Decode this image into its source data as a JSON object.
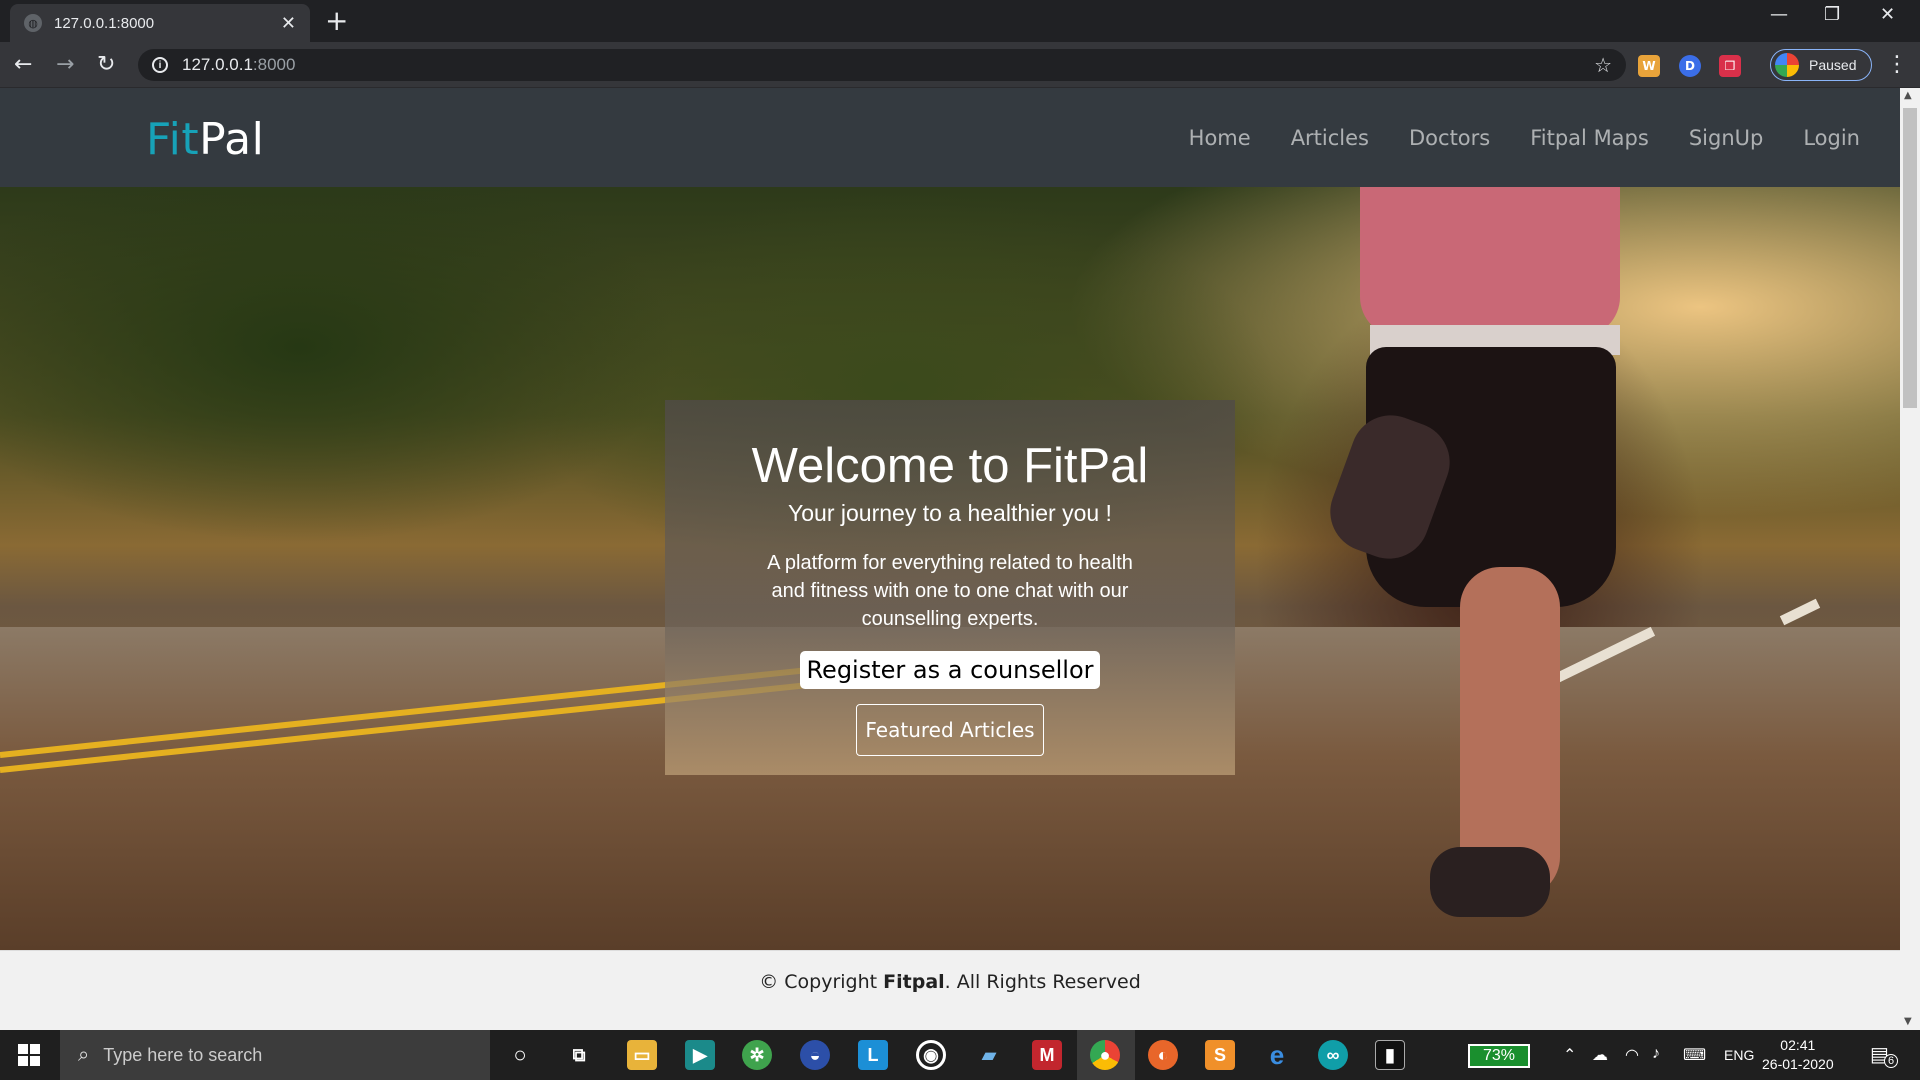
{
  "browser": {
    "tab_title": "127.0.0.1:8000",
    "url_host": "127.0.0.1",
    "url_port": ":8000",
    "profile_status": "Paused"
  },
  "site": {
    "brand_part1": "Fit",
    "brand_part2": "Pal",
    "nav": [
      "Home",
      "Articles",
      "Doctors",
      "Fitpal Maps",
      "SignUp",
      "Login"
    ],
    "hero": {
      "title": "Welcome to FitPal",
      "subtitle": "Your journey to a healthier you !",
      "description": "A platform for everything related to health and fitness with one to one chat with our counselling experts.",
      "register_button": "Register as a counsellor",
      "featured_button": "Featured Articles"
    },
    "footer": {
      "prefix": "© Copyright ",
      "brand": "Fitpal",
      "suffix": ". All Rights Reserved"
    }
  },
  "taskbar": {
    "search_placeholder": "Type here to search",
    "battery": "73%",
    "language": "ENG",
    "time": "02:41",
    "date": "26-01-2020",
    "notification_count": "6"
  }
}
